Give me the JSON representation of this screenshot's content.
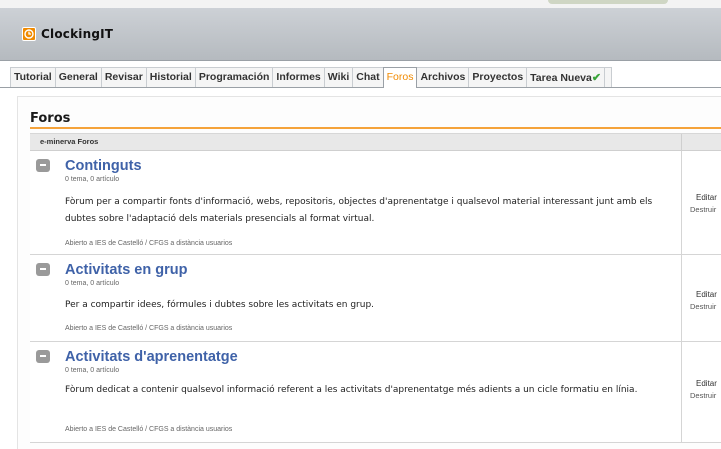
{
  "app": {
    "name": "ClockingIT",
    "icon": "clock-icon"
  },
  "tabs": [
    {
      "label": "Tutorial"
    },
    {
      "label": "General"
    },
    {
      "label": "Revisar"
    },
    {
      "label": "Historial"
    },
    {
      "label": "Programación"
    },
    {
      "label": "Informes"
    },
    {
      "label": "Wiki"
    },
    {
      "label": "Chat"
    },
    {
      "label": "Foros",
      "active": true
    },
    {
      "label": "Archivos"
    },
    {
      "label": "Proyectos"
    },
    {
      "label": "Tarea Nueva",
      "icon": "checkmark-icon"
    }
  ],
  "page": {
    "title": "Foros"
  },
  "table": {
    "header": "e-minerva Foros"
  },
  "forums": [
    {
      "title": "Continguts",
      "meta": "0 tema, 0 artículo",
      "description": "Fòrum per a compartir fonts d'informació, webs, repositoris, objectes d'aprenentatge i qualsevol material interessant junt amb els dubtes sobre l'adaptació dels materials presencials al format virtual.",
      "footer": "Abierto a IES de Castelló / CFGS a distància usuarios",
      "edit": "Editar",
      "destroy": "Destruir"
    },
    {
      "title": "Activitats en grup",
      "meta": "0 tema, 0 artículo",
      "description": "Per a compartir idees, fórmules i dubtes sobre les activitats en grup.",
      "footer": "Abierto a IES de Castelló / CFGS a distància usuarios",
      "edit": "Editar",
      "destroy": "Destruir"
    },
    {
      "title": "Activitats d'aprenentatge",
      "meta": "0 tema, 0 artículo",
      "description": "Fòrum dedicat a contenir qualsevol informació referent a les activitats d'aprenentatge més adients a un cicle formatiu en línia.",
      "footer": "Abierto a IES de Castelló / CFGS a distància usuarios",
      "edit": "Editar",
      "destroy": "Destruir"
    }
  ],
  "colors": {
    "accent": "#f08a00",
    "link": "#3f62a8",
    "rule": "#f5a33b"
  }
}
